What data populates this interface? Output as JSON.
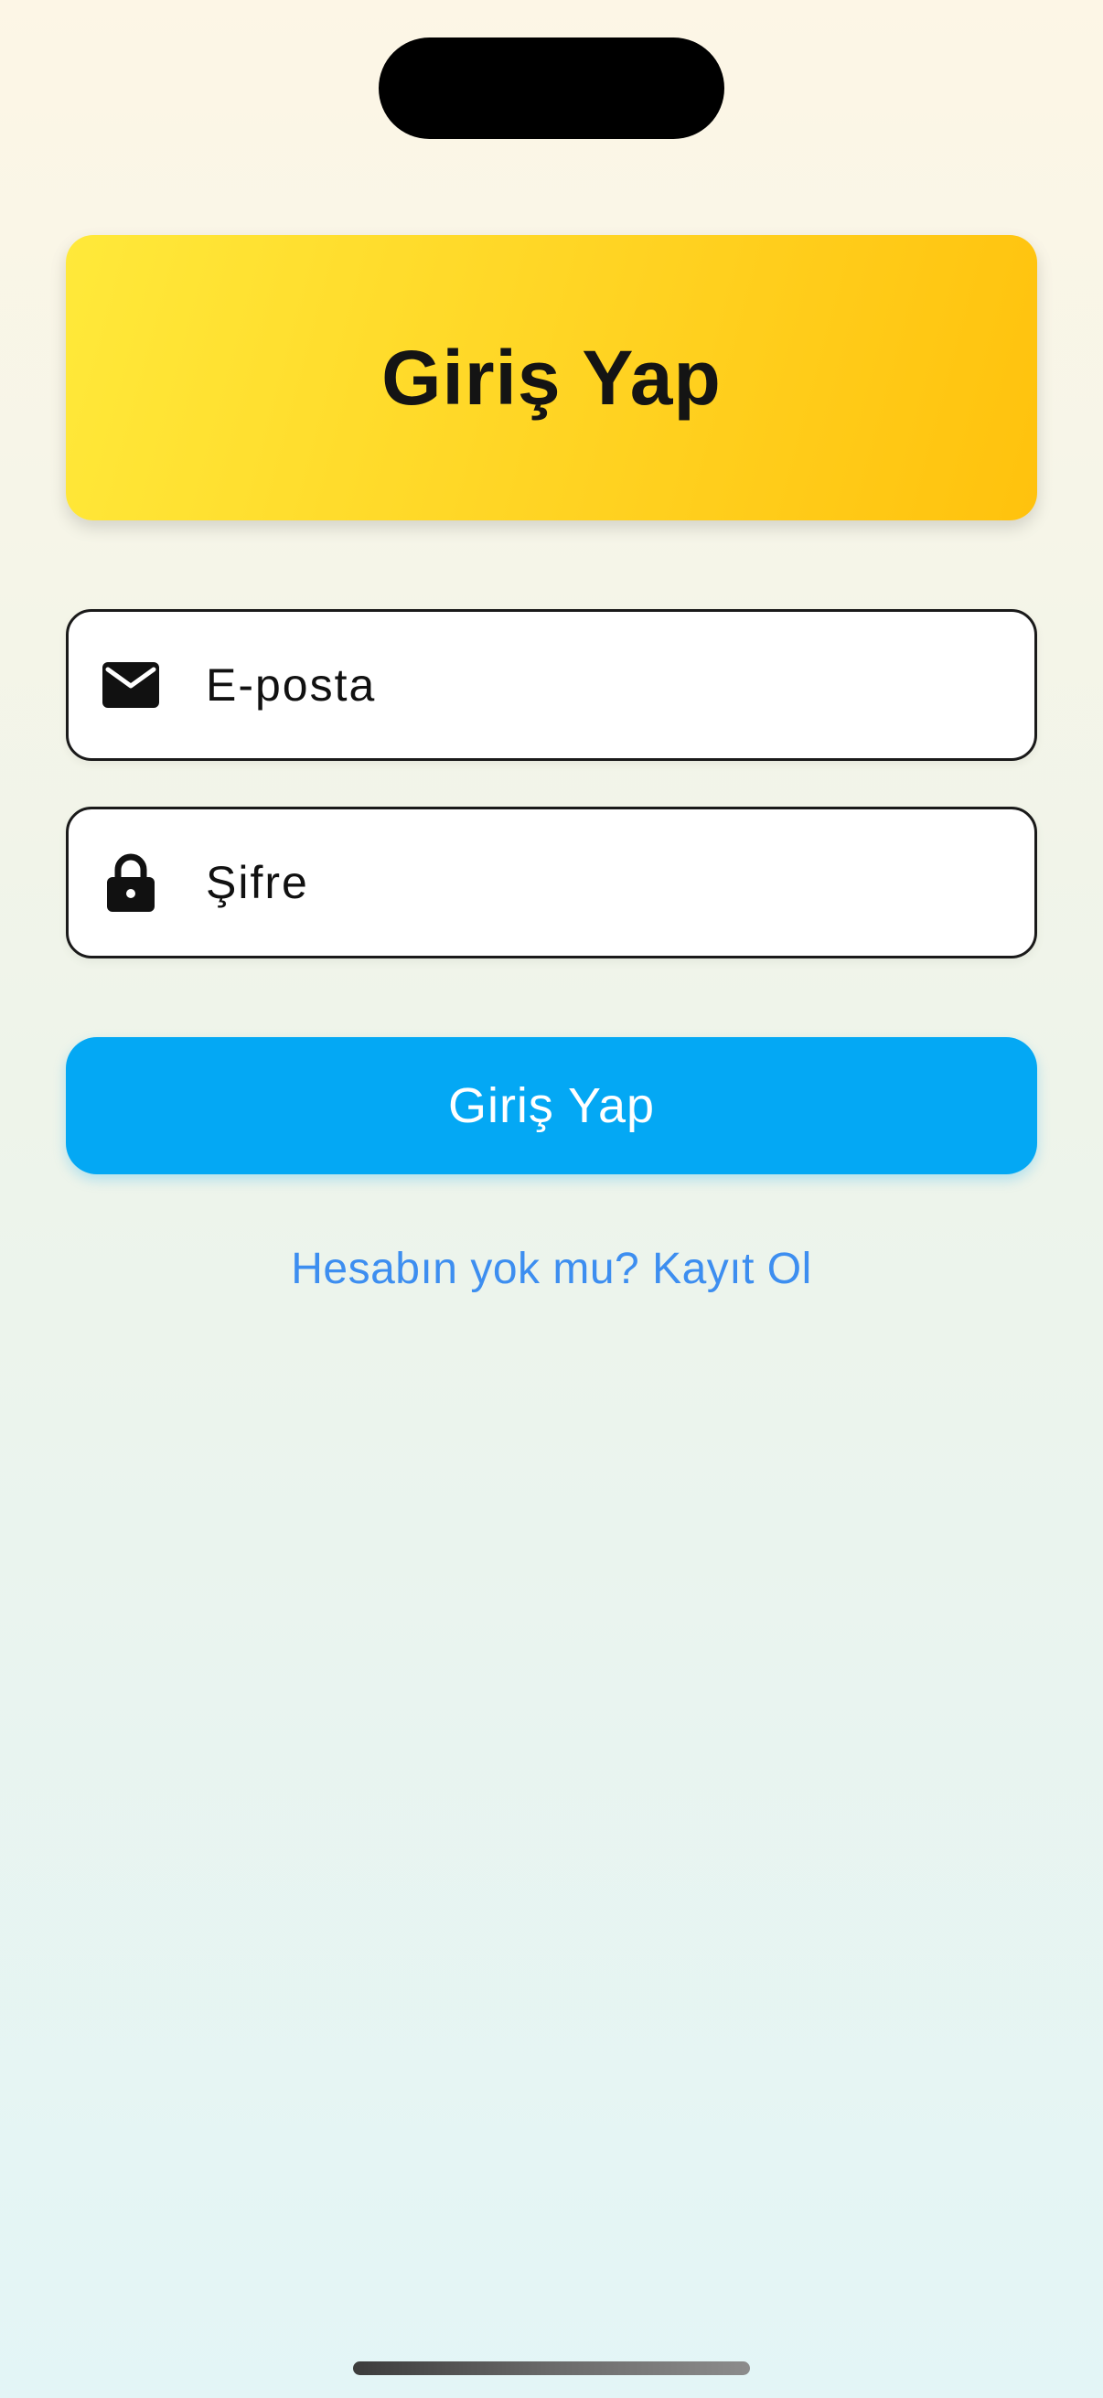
{
  "header": {
    "title": "Giriş Yap"
  },
  "form": {
    "email": {
      "placeholder": "E-posta",
      "value": "",
      "icon": "mail-icon"
    },
    "password": {
      "placeholder": "Şifre",
      "value": "",
      "icon": "lock-icon"
    },
    "submit_label": "Giriş Yap",
    "signup_link": "Hesabın yok mu? Kayıt Ol"
  },
  "colors": {
    "title_card_start": "#ffe93a",
    "title_card_end": "#ffc20d",
    "button": "#04a8f4",
    "link": "#3d8ef0"
  }
}
